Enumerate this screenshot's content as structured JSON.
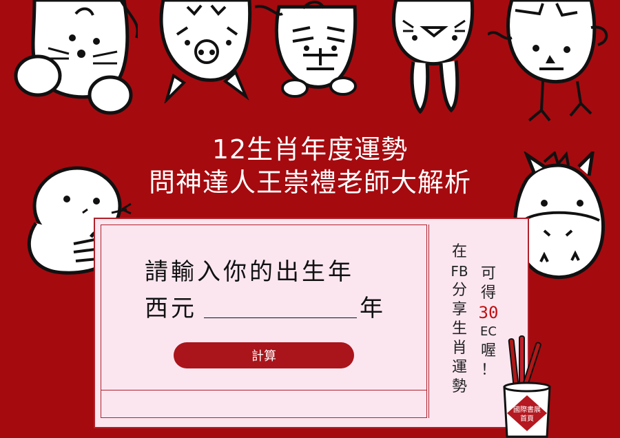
{
  "title_line1": "12生肖年度運勢",
  "title_line2": "問神達人王崇禮老師大解析",
  "prompt_line1": "請輸入你的出生年",
  "prompt_prefix": "西元",
  "prompt_suffix": "年",
  "year_input": {
    "value": "",
    "placeholder": ""
  },
  "calc_button": "計算",
  "side_note_col1": [
    "在",
    "FB",
    "分",
    "享",
    "生",
    "肖",
    "運",
    "勢"
  ],
  "side_note_col2_top": [
    "可",
    "得"
  ],
  "side_note_highlight": "30",
  "side_note_col2_bottom": [
    "EC",
    "喔",
    "！"
  ],
  "homepage_link": "國際書展首頁",
  "homepage_line1": "國際書展",
  "homepage_line2": "首頁",
  "colors": {
    "background": "#a50a0f",
    "card": "#fbe6f0",
    "button": "#a9151b",
    "highlight": "#c01010"
  },
  "decorations": [
    "rat-icon",
    "ox-icon",
    "tiger-icon",
    "rabbit-icon",
    "rooster-icon",
    "snake-icon",
    "horse-icon",
    "fortune-sticks-icon"
  ]
}
